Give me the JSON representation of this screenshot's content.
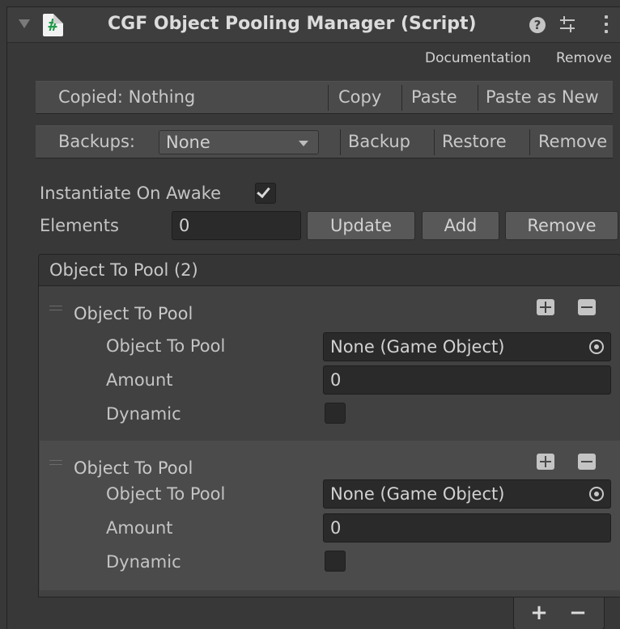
{
  "header": {
    "title": "CGF Object Pooling Manager (Script)",
    "script_icon_glyph": "#",
    "icons": [
      "foldout-arrow-icon",
      "script-icon",
      "help-icon",
      "preset-icon",
      "kebab-menu-icon"
    ]
  },
  "links": {
    "documentation": "Documentation",
    "remove": "Remove"
  },
  "copy_bar": {
    "status": "Copied: Nothing",
    "copy": "Copy",
    "paste": "Paste",
    "paste_as_new": "Paste as New"
  },
  "backup_bar": {
    "label": "Backups:",
    "selected": "None",
    "backup": "Backup",
    "restore": "Restore",
    "remove": "Remove"
  },
  "settings": {
    "instantiate_label": "Instantiate On Awake",
    "instantiate_checked": true,
    "elements_label": "Elements",
    "elements_value": "0",
    "update": "Update",
    "add": "Add",
    "remove": "Remove"
  },
  "list": {
    "header": "Object To Pool (2)",
    "items": [
      {
        "title": "Object To Pool",
        "object_label": "Object To Pool",
        "object_value": "None (Game Object)",
        "amount_label": "Amount",
        "amount_value": "0",
        "dynamic_label": "Dynamic",
        "dynamic_checked": false
      },
      {
        "title": "Object To Pool",
        "object_label": "Object To Pool",
        "object_value": "None (Game Object)",
        "amount_label": "Amount",
        "amount_value": "0",
        "dynamic_label": "Dynamic",
        "dynamic_checked": false
      }
    ],
    "footer_add": "+",
    "footer_remove": "−"
  },
  "colors": {
    "background": "#383838",
    "field": "#2a2a2a",
    "button": "#585858",
    "text": "#c8c8c8",
    "script_icon_green": "#1f9a4a"
  }
}
